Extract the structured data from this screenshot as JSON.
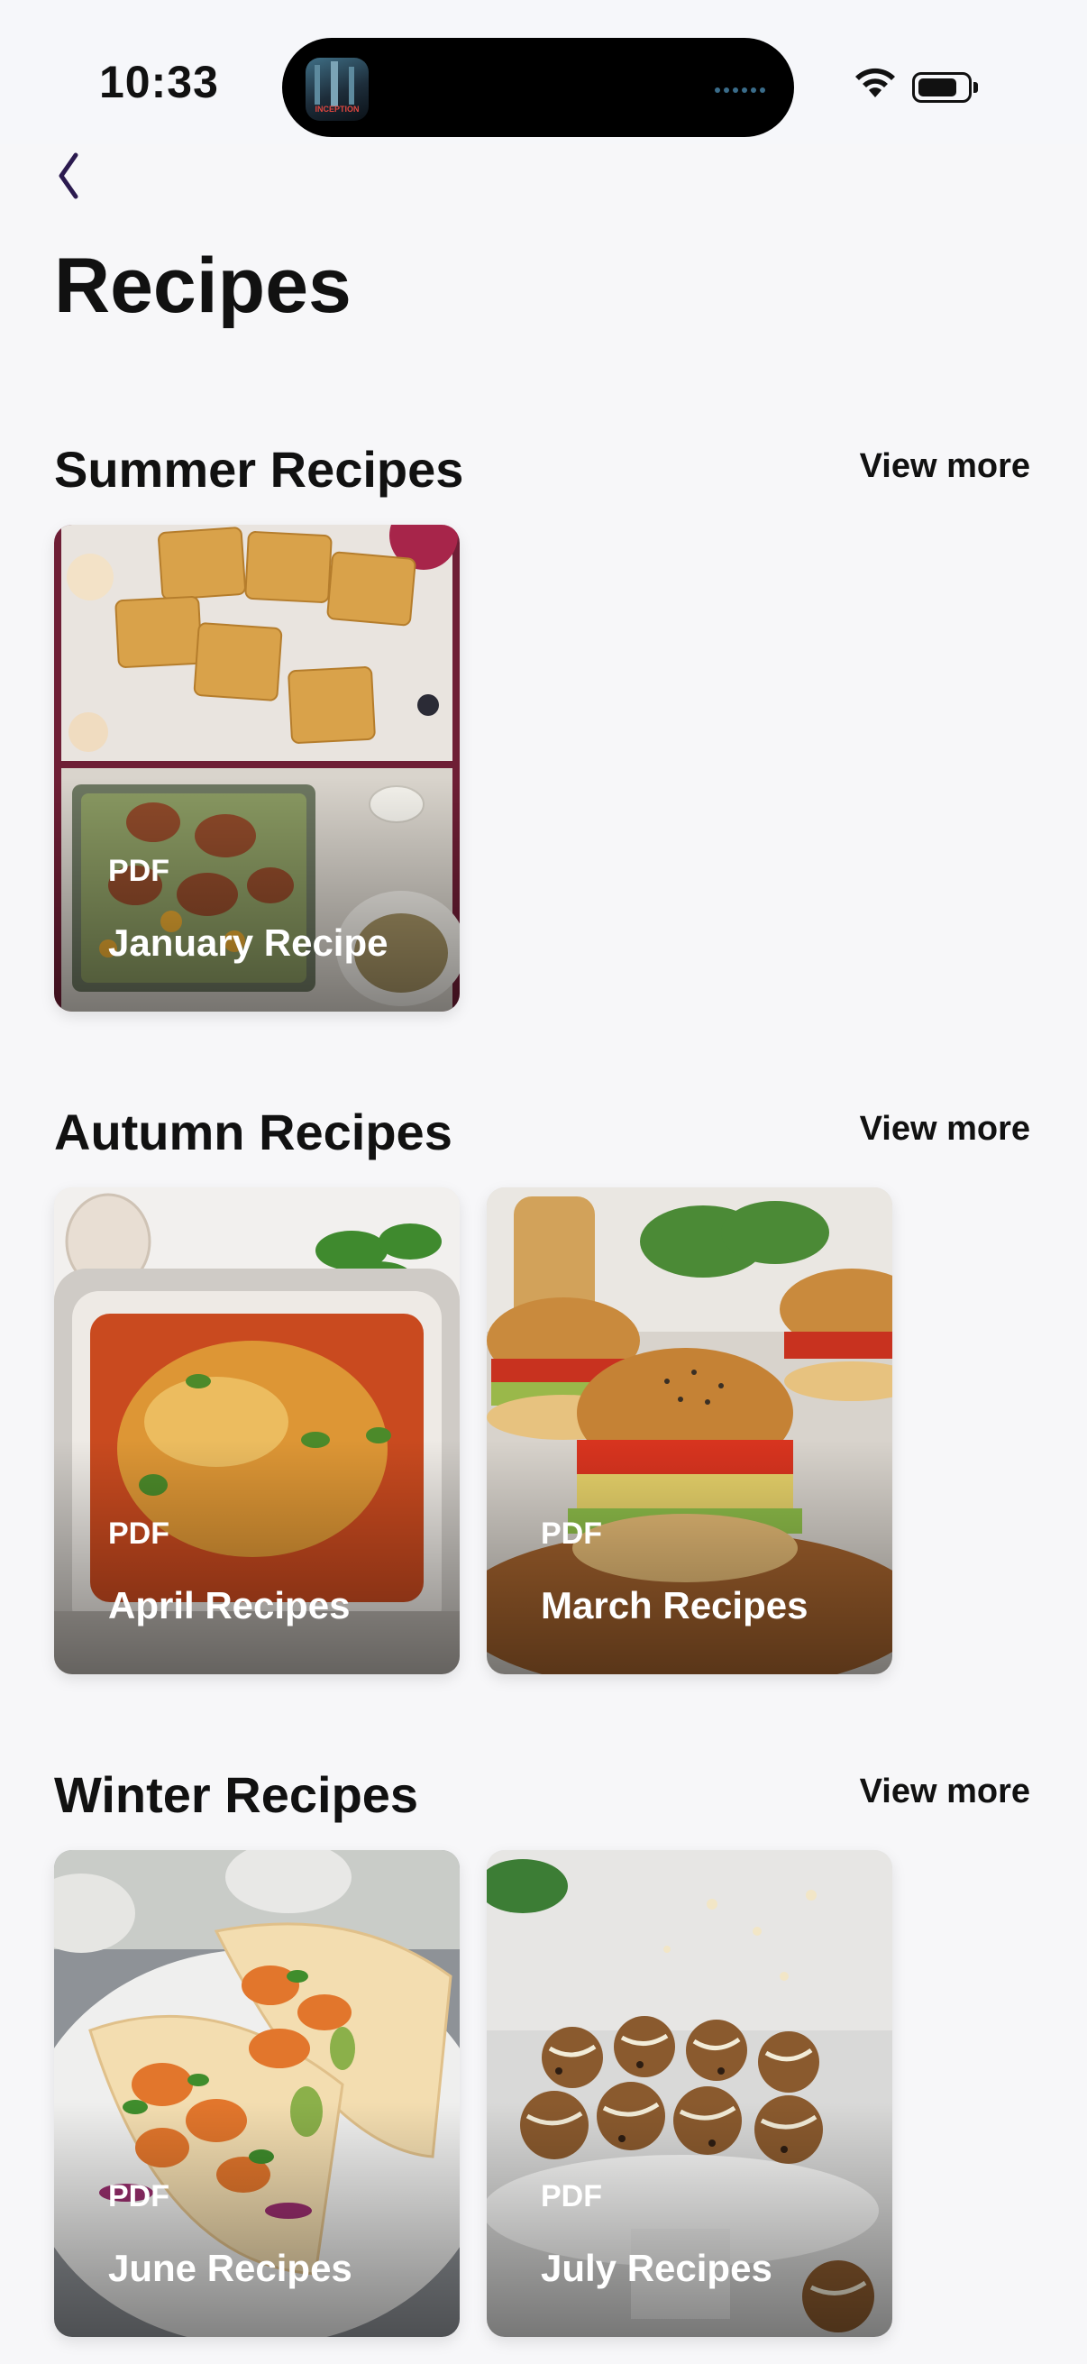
{
  "status_bar": {
    "time": "10:33",
    "island_thumbnail_text": "INCEPTION"
  },
  "page": {
    "title": "Recipes"
  },
  "sections": [
    {
      "title": "Summer Recipes",
      "view_more": "View more",
      "cards": [
        {
          "kind": "PDF",
          "title": "January Recipe",
          "image": "pastries-and-chicken-collage"
        }
      ]
    },
    {
      "title": "Autumn Recipes",
      "view_more": "View more",
      "cards": [
        {
          "kind": "PDF",
          "title": "April Recipes",
          "image": "baked-pasta-casserole"
        },
        {
          "kind": "PDF",
          "title": "March Recipes",
          "image": "halloumi-burgers"
        }
      ]
    },
    {
      "title": "Winter Recipes",
      "view_more": "View more",
      "cards": [
        {
          "kind": "PDF",
          "title": "June Recipes",
          "image": "shrimp-tacos"
        },
        {
          "kind": "PDF",
          "title": "July Recipes",
          "image": "cookie-dough-bites"
        }
      ]
    }
  ],
  "icons": {
    "back": "chevron-left-icon",
    "wifi": "wifi-icon",
    "battery": "battery-icon"
  },
  "colors": {
    "background": "#f7f7f9",
    "text": "#111111",
    "back_chevron": "#2b1a4f"
  }
}
